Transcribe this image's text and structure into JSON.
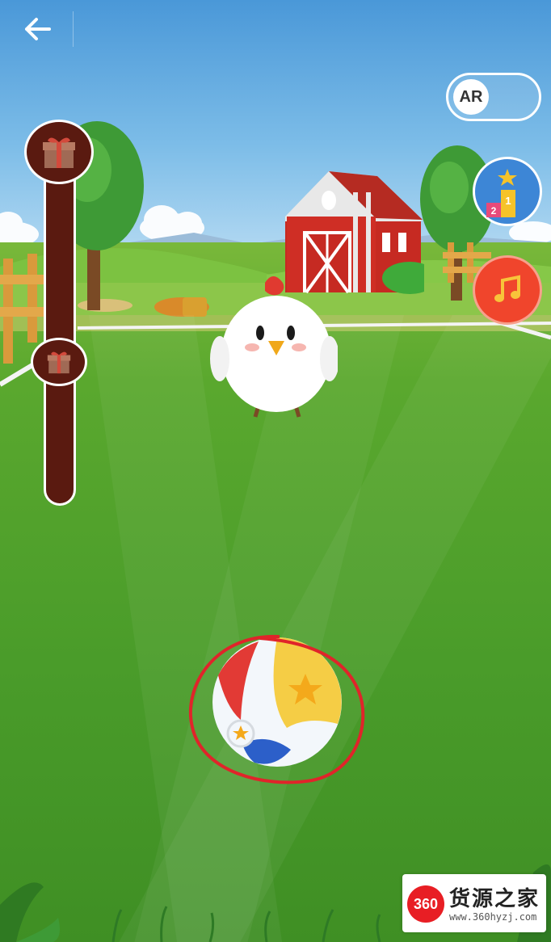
{
  "toolbar": {
    "back_icon": "arrow-left-icon"
  },
  "ar_toggle": {
    "label": "AR",
    "state": "off"
  },
  "side_buttons": [
    {
      "name": "leaderboard",
      "icon": "podium-icon",
      "podium_numbers": [
        "1",
        "2"
      ]
    },
    {
      "name": "music",
      "icon": "music-note-icon"
    }
  ],
  "reward_slider": {
    "icons": [
      "gift-icon",
      "gift-icon"
    ]
  },
  "scene": {
    "character": "chicken",
    "ball": "beach-ball",
    "colors": {
      "sky": "#4a98d8",
      "grass": "#4a9c2a",
      "barn": "#c62a22",
      "highlight_circle": "#e0242a"
    }
  },
  "watermark": {
    "logo": "360",
    "title": "货源之家",
    "url": "www.360hyzj.com"
  }
}
